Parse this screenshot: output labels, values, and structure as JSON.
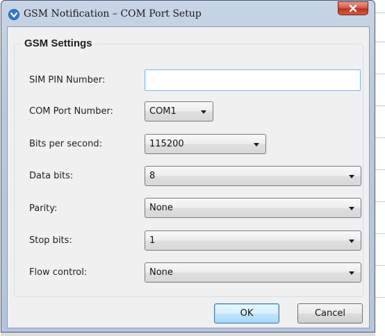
{
  "window": {
    "title": "GSM Notification – COM Port Setup",
    "icon": "gsm-app-icon",
    "close_icon": "close-x-icon"
  },
  "group": {
    "title": "GSM Settings"
  },
  "fields": {
    "sim_pin": {
      "label": "SIM PIN Number:",
      "value": ""
    },
    "com_port": {
      "label": "COM Port Number:",
      "value": "COM1"
    },
    "bits_per_second": {
      "label": "Bits per second:",
      "value": "115200"
    },
    "data_bits": {
      "label": "Data bits:",
      "value": "8"
    },
    "parity": {
      "label": "Parity:",
      "value": "None"
    },
    "stop_bits": {
      "label": "Stop bits:",
      "value": "1"
    },
    "flow_control": {
      "label": "Flow control:",
      "value": "None"
    }
  },
  "buttons": {
    "ok": "OK",
    "cancel": "Cancel"
  },
  "colors": {
    "title_bar": "#b9cade",
    "close_button": "#c7432f",
    "client_bg": "#f0f0f0",
    "default_button": "#bee6fd",
    "focus_border": "#7eb4ea"
  }
}
